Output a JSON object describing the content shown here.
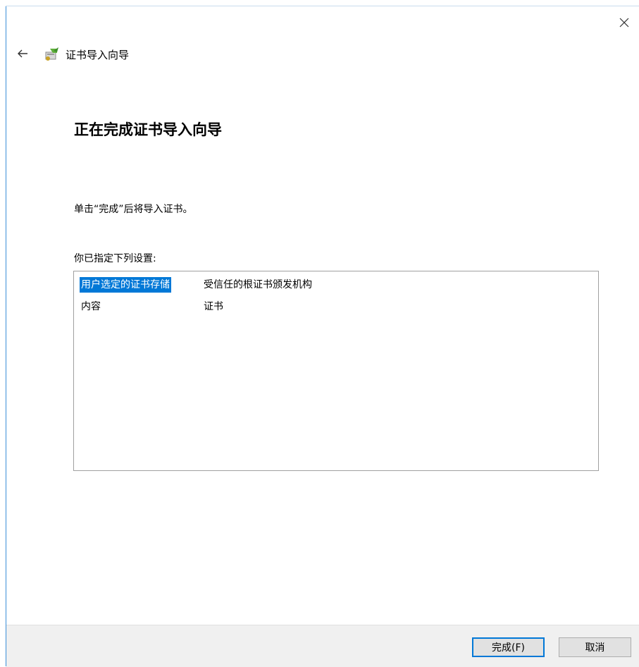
{
  "window": {
    "partial_title_text": "...",
    "close_glyph": "✕",
    "back_glyph": "←"
  },
  "wizard": {
    "title": "证书导入向导",
    "icon": "certificate-wizard-icon"
  },
  "main": {
    "heading": "正在完成证书导入向导",
    "instruction": "单击“完成”后将导入证书。",
    "settings_label": "你已指定下列设置:",
    "settings": [
      {
        "key": "用户选定的证书存储",
        "value": "受信任的根证书颁发机构",
        "selected": true
      },
      {
        "key": "内容",
        "value": "证书",
        "selected": false
      }
    ]
  },
  "footer": {
    "finish_label": "完成(F)",
    "cancel_label": "取消"
  },
  "colors": {
    "accent": "#0078d7",
    "footer_bg": "#f0f0f0",
    "button_bg": "#e1e1e1"
  }
}
